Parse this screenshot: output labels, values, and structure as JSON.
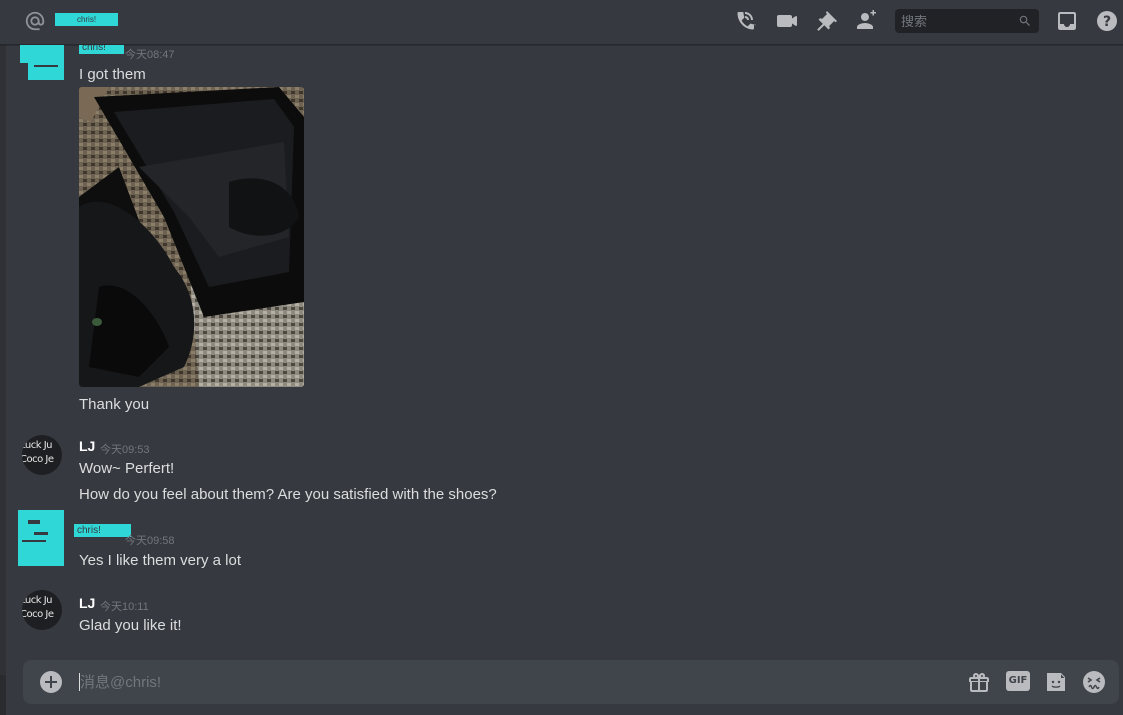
{
  "header": {
    "channel_name": "chris!",
    "search_placeholder": "搜索",
    "icons": [
      "voice-call-icon",
      "video-call-icon",
      "pin-icon",
      "add-friend-icon",
      "inbox-icon",
      "help-icon"
    ]
  },
  "messages": [
    {
      "author": "chris!",
      "timestamp": "今天08:47",
      "lines": [
        "I got them"
      ],
      "attachment": "photo of black shoes in a shoebox on a woven rug",
      "after_lines": [
        "Thank you"
      ]
    },
    {
      "author": "LJ",
      "avatar_text": [
        "Luck Ju",
        "Coco Je"
      ],
      "timestamp": "今天09:53",
      "lines": [
        "Wow~ Perfert!",
        "How do you feel about them? Are you satisfied with the shoes?"
      ]
    },
    {
      "author": "chris!",
      "timestamp": "今天09:58",
      "lines": [
        "Yes I like them very a lot"
      ]
    },
    {
      "author": "LJ",
      "avatar_text": [
        "Luck Ju",
        "Coco Je"
      ],
      "timestamp": "今天10:11",
      "lines": [
        "Glad you like it!"
      ]
    }
  ],
  "composer": {
    "placeholder": "消息@chris!",
    "icons": [
      "add-attachment-icon",
      "gift-icon",
      "gif-icon",
      "sticker-icon",
      "emoji-icon"
    ],
    "gif_label": "GIF"
  },
  "colors": {
    "background": "#36393f",
    "redaction": "#2fd7d7",
    "input_bg": "#40444b",
    "muted": "#72767d"
  }
}
